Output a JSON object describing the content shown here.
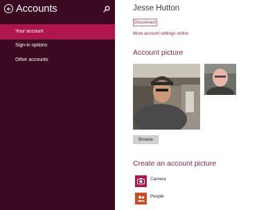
{
  "sidebar": {
    "title": "Accounts",
    "back_icon": "back-arrow-icon",
    "search_icon": "search-icon",
    "background_color": "#3b0a22",
    "active_color": "#b1154d",
    "items": [
      {
        "label": "Your account",
        "active": true
      },
      {
        "label": "Sign-in options",
        "active": false
      },
      {
        "label": "Other accounts",
        "active": false
      }
    ]
  },
  "account": {
    "name": "Jesse Hutton",
    "disconnect_label": "Disconnect",
    "more_settings_label": "More account settings online"
  },
  "account_picture": {
    "title": "Account picture",
    "browse_label": "Browse"
  },
  "create_picture": {
    "title": "Create an account picture",
    "apps": [
      {
        "label": "Camera",
        "icon": "camera-icon",
        "color": "#b1154d"
      },
      {
        "label": "People",
        "icon": "people-icon",
        "color": "#d04a1f"
      }
    ]
  }
}
